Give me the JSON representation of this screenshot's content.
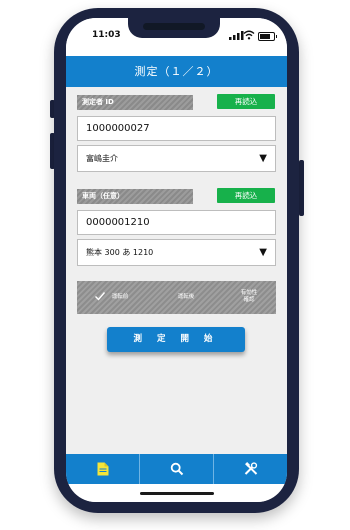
{
  "status": {
    "time": "11:03"
  },
  "header": {
    "title": "測定（１／２）"
  },
  "measurer": {
    "label": "測定者 ID",
    "reload_label": "再読込",
    "id_value": "1000000027",
    "name_value": "富嶋圭介"
  },
  "vehicle": {
    "label": "車両（任意）",
    "reload_label": "再読込",
    "number_value": "0000001210",
    "plate_value": "熊本 300 あ 1210"
  },
  "steps": {
    "items": [
      "運転前",
      "運転後",
      "有効性\n確認"
    ],
    "completed": [
      true,
      false,
      false
    ]
  },
  "actions": {
    "start_label": "測 定 開 始"
  },
  "tabbar": {
    "tabs": [
      {
        "icon": "document-icon",
        "active": true
      },
      {
        "icon": "search-icon",
        "active": false
      },
      {
        "icon": "tools-icon",
        "active": false
      }
    ]
  },
  "colors": {
    "primary": "#1380cc",
    "success": "#17b14b",
    "active_icon": "#f5e53a"
  }
}
